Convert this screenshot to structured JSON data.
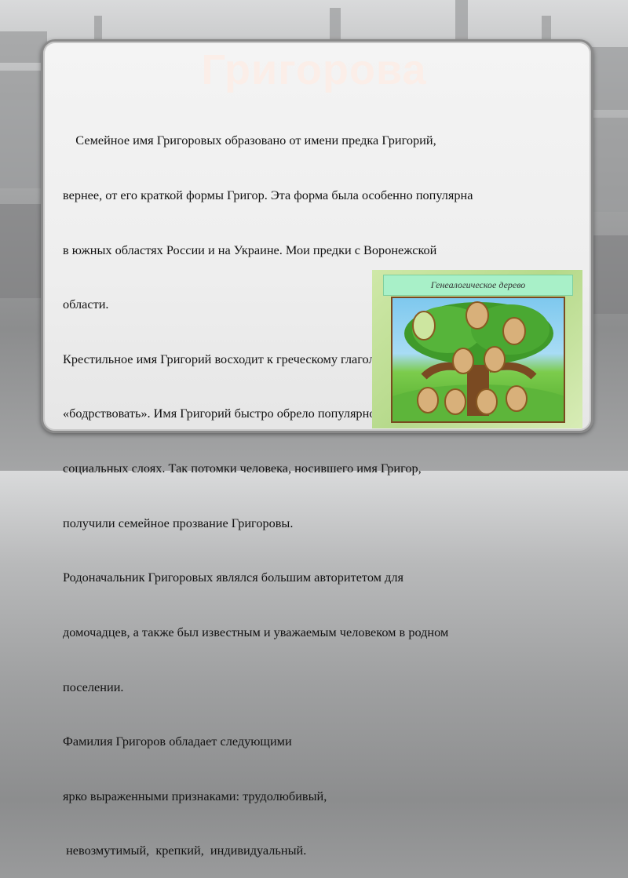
{
  "slide": {
    "title": "Григорова",
    "lines": [
      "    Семейное имя Григоровых образовано от имени предка Григорий,",
      "вернее, от его краткой формы Григор. Эта форма была особенно популярна",
      "в южных областях России и на Украине. Мои предки с Воронежской",
      "области.",
      "Крестильное имя Григорий восходит к греческому глаголу «григорео» –",
      "«бодрствовать». Имя Григорий быстро обрело популярность во всех",
      "социальных слоях. Так потомки человека, носившего имя Григор,",
      "получили семейное прозвание Григоровы.",
      "Родоначальник Григоровых являлся большим авторитетом для",
      "домочадцев, а также был известным и уважаемым человеком в родном",
      "поселении.",
      "Фамилия Григоров обладает следующими",
      "ярко выраженными признаками: трудолюбивый,",
      " невозмутимый,  крепкий,  индивидуальный."
    ],
    "tree_image": {
      "caption": "Генеалогическое дерево"
    }
  }
}
